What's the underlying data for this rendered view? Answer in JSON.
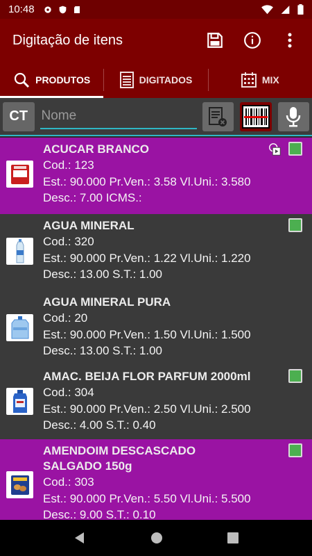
{
  "status_bar": {
    "time": "10:48",
    "icons": [
      "gear-icon",
      "shield-icon",
      "sd-card-icon"
    ],
    "right_icons": [
      "wifi-icon",
      "signal-icon",
      "battery-icon"
    ]
  },
  "app_bar": {
    "title": "Digitação de itens",
    "actions": [
      "save-icon",
      "info-icon",
      "more-vert-icon"
    ]
  },
  "tabs": [
    {
      "label": "PRODUTOS",
      "icon": "search-icon",
      "active": true
    },
    {
      "label": "DIGITADOS",
      "icon": "list-icon",
      "active": false
    },
    {
      "label": "MIX",
      "icon": "calendar-icon",
      "active": false
    }
  ],
  "search": {
    "ct_label": "CT",
    "placeholder": "Nome",
    "value": ""
  },
  "items": [
    {
      "name": "ACUCAR BRANCO",
      "cod": "Cod.: 123",
      "line2": "Est.: 90.000 Pr.Ven.: 3.58 Vl.Uni.: 3.580",
      "line3": "Desc.: 7.00 ICMS.:",
      "color": "#9a13a3",
      "checked": true,
      "has_play": true
    },
    {
      "name": "AGUA MINERAL",
      "cod": "Cod.: 320",
      "line2": "Est.: 90.000 Pr.Ven.: 1.22 Vl.Uni.: 1.220",
      "line3": "Desc.: 13.00 S.T.: 1.00",
      "color": "#3a3a3a",
      "checked": true,
      "has_play": false
    },
    {
      "name": "AGUA MINERAL PURA",
      "cod": "Cod.: 20",
      "line2": "Est.: 90.000 Pr.Ven.: 1.50 Vl.Uni.: 1.500",
      "line3": "Desc.: 13.00 S.T.: 1.00",
      "color": "#3a3a3a",
      "checked": false,
      "has_play": false
    },
    {
      "name": "AMAC. BEIJA FLOR PARFUM 2000ml",
      "cod": "Cod.: 304",
      "line2": "Est.: 90.000 Pr.Ven.: 2.50 Vl.Uni.: 2.500",
      "line3": "Desc.: 4.00 S.T.: 0.40",
      "color": "#3a3a3a",
      "checked": true,
      "has_play": false
    },
    {
      "name": "AMENDOIM DESCASCADO SALGADO 150g",
      "cod": "Cod.: 303",
      "line2": "Est.: 90.000 Pr.Ven.: 5.50 Vl.Uni.: 5.500",
      "line3": "Desc.: 9.00 S.T.: 0.10",
      "color": "#9a13a3",
      "checked": true,
      "has_play": false
    }
  ],
  "nav": [
    "back-icon",
    "home-icon",
    "recents-icon"
  ],
  "colors": {
    "primary": "#7d0000",
    "accent": "#2fb7c5",
    "highlight_row": "#9a13a3",
    "check_green": "#4caf50"
  }
}
